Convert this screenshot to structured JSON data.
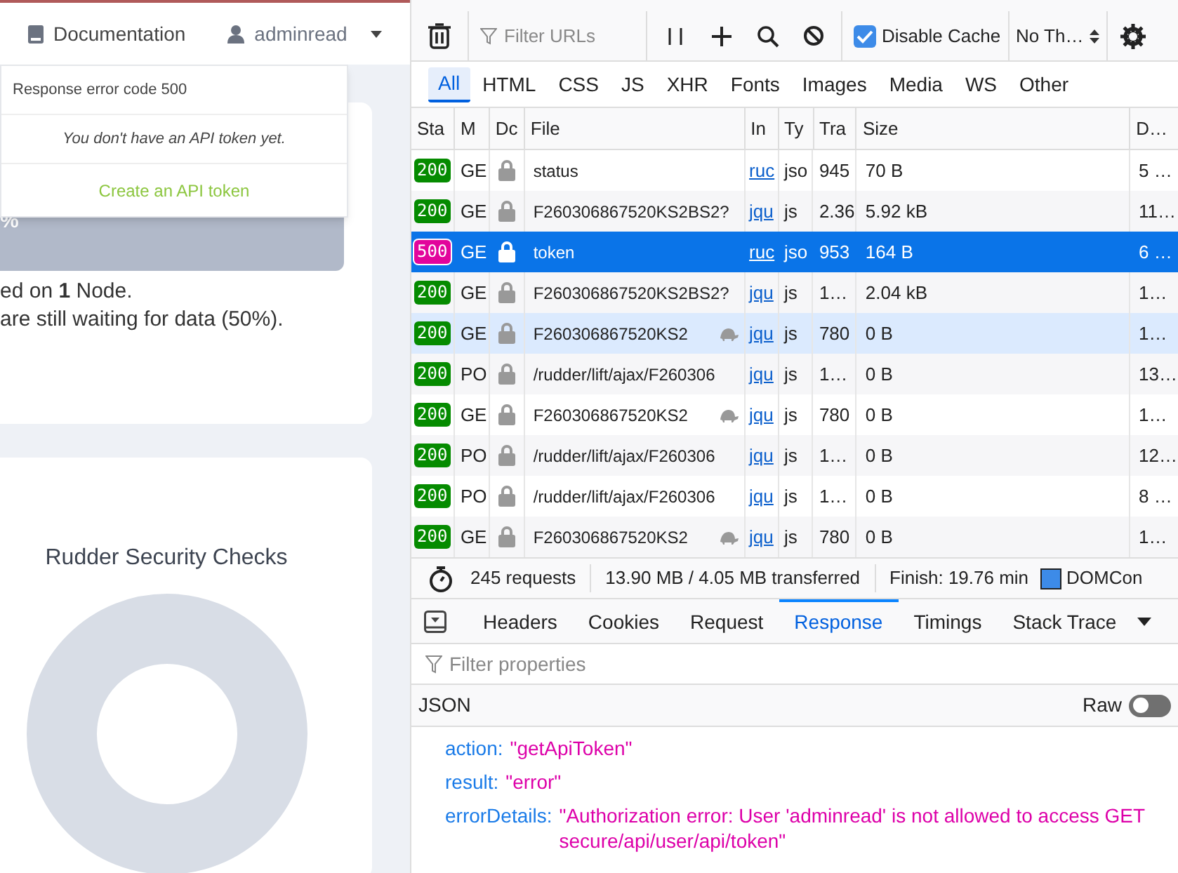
{
  "header": {
    "documentation_link": "Documentation",
    "user_menu": "adminread"
  },
  "token_dropdown": {
    "message": "Response error code 500",
    "note": "You don't have an API token yet.",
    "action": "Create an API token"
  },
  "compliance_card": {
    "bar_text": "%",
    "lines": [
      "ed on **1** Node.",
      "are still waiting for data (50%)."
    ]
  },
  "security_card": {
    "title": "Rudder Security Checks"
  },
  "devtools": {
    "toolbar": {
      "filter_placeholder": "Filter URLs",
      "disable_cache": {
        "label": "Disable Cache",
        "checked": true
      },
      "throttling": "No Th…"
    },
    "type_filters": [
      {
        "label": "All",
        "selected": true
      },
      {
        "label": "HTML",
        "selected": false
      },
      {
        "label": "CSS",
        "selected": false
      },
      {
        "label": "JS",
        "selected": false
      },
      {
        "label": "XHR",
        "selected": false
      },
      {
        "label": "Fonts",
        "selected": false
      },
      {
        "label": "Images",
        "selected": false
      },
      {
        "label": "Media",
        "selected": false
      },
      {
        "label": "WS",
        "selected": false
      },
      {
        "label": "Other",
        "selected": false
      }
    ],
    "columns": [
      "Sta",
      "M",
      "Dc",
      "File",
      "In",
      "Ty",
      "Tra",
      "Size",
      "D…"
    ],
    "rows": [
      {
        "status": "200",
        "color": "#058b00",
        "method": "GE",
        "file": "status",
        "slow": false,
        "initiator": "ruc",
        "type": "jso",
        "transferred": "945",
        "size": "70 B",
        "duration": "5 …",
        "selected": false,
        "highlighted": false
      },
      {
        "status": "200",
        "color": "#058b00",
        "method": "GE",
        "file": "F260306867520KS2BS2?",
        "slow": false,
        "initiator": "jqu",
        "type": "js",
        "transferred": "2.36",
        "size": "5.92 kB",
        "duration": "11…",
        "selected": false,
        "highlighted": false
      },
      {
        "status": "500",
        "color": "#e2049c",
        "method": "GE",
        "file": "token",
        "slow": false,
        "initiator": "ruc",
        "type": "jso",
        "transferred": "953",
        "size": "164 B",
        "duration": "6 …",
        "selected": true,
        "highlighted": false
      },
      {
        "status": "200",
        "color": "#058b00",
        "method": "GE",
        "file": "F260306867520KS2BS2?",
        "slow": false,
        "initiator": "jqu",
        "type": "js",
        "transferred": "1…",
        "size": "2.04 kB",
        "duration": "1…",
        "selected": false,
        "highlighted": false
      },
      {
        "status": "200",
        "color": "#058b00",
        "method": "GE",
        "file": "F260306867520KS2",
        "slow": true,
        "initiator": "jqu",
        "type": "js",
        "transferred": "780",
        "size": "0 B",
        "duration": "1…",
        "selected": false,
        "highlighted": true
      },
      {
        "status": "200",
        "color": "#058b00",
        "method": "PO",
        "file": "/rudder/lift/ajax/F260306",
        "slow": false,
        "initiator": "jqu",
        "type": "js",
        "transferred": "1…",
        "size": "0 B",
        "duration": "13…",
        "selected": false,
        "highlighted": false
      },
      {
        "status": "200",
        "color": "#058b00",
        "method": "GE",
        "file": "F260306867520KS2",
        "slow": true,
        "initiator": "jqu",
        "type": "js",
        "transferred": "780",
        "size": "0 B",
        "duration": "1…",
        "selected": false,
        "highlighted": false
      },
      {
        "status": "200",
        "color": "#058b00",
        "method": "PO",
        "file": "/rudder/lift/ajax/F260306",
        "slow": false,
        "initiator": "jqu",
        "type": "js",
        "transferred": "1…",
        "size": "0 B",
        "duration": "12…",
        "selected": false,
        "highlighted": false
      },
      {
        "status": "200",
        "color": "#058b00",
        "method": "PO",
        "file": "/rudder/lift/ajax/F260306",
        "slow": false,
        "initiator": "jqu",
        "type": "js",
        "transferred": "1…",
        "size": "0 B",
        "duration": "8 …",
        "selected": false,
        "highlighted": false
      },
      {
        "status": "200",
        "color": "#058b00",
        "method": "GE",
        "file": "F260306867520KS2",
        "slow": true,
        "initiator": "jqu",
        "type": "js",
        "transferred": "780",
        "size": "0 B",
        "duration": "1…",
        "selected": false,
        "highlighted": false
      }
    ],
    "summary": {
      "requests": "245 requests",
      "transferred": "13.90 MB / 4.05 MB transferred",
      "finish": "Finish: 19.76 min",
      "dom": "DOMCon"
    },
    "detail_tabs": [
      {
        "label": "Headers",
        "selected": false
      },
      {
        "label": "Cookies",
        "selected": false
      },
      {
        "label": "Request",
        "selected": false
      },
      {
        "label": "Response",
        "selected": true
      },
      {
        "label": "Timings",
        "selected": false
      },
      {
        "label": "Stack Trace",
        "selected": false
      }
    ],
    "properties_filter_placeholder": "Filter properties",
    "json_label": "JSON",
    "raw": {
      "label": "Raw",
      "on": false
    },
    "properties": [
      {
        "key": "action:",
        "value": "\"getApiToken\""
      },
      {
        "key": "result:",
        "value": "\"error\""
      },
      {
        "key": "errorDetails:",
        "value": "\"Authorization error: User 'adminread' is not allowed to access GET secure/api/user/api/token\""
      }
    ]
  }
}
